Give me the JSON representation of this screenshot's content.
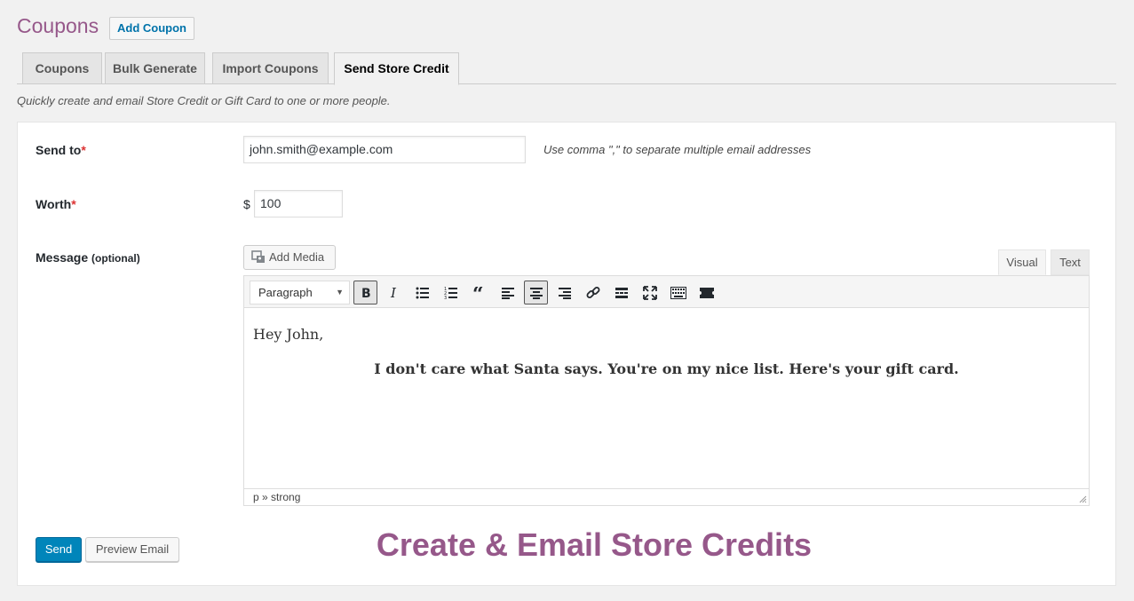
{
  "header": {
    "title": "Coupons",
    "add_button": "Add Coupon"
  },
  "tabs": [
    {
      "label": "Coupons"
    },
    {
      "label": "Bulk Generate"
    },
    {
      "label": "Import Coupons"
    },
    {
      "label": "Send Store Credit",
      "active": true
    }
  ],
  "subtitle": "Quickly create and email Store Credit or Gift Card to one or more people.",
  "form": {
    "send_to": {
      "label": "Send to",
      "required_mark": "*",
      "value": "john.smith@example.com",
      "hint": "Use comma \",\" to separate multiple email addresses"
    },
    "worth": {
      "label": "Worth",
      "required_mark": "*",
      "currency": "$",
      "value": "100"
    },
    "message": {
      "label": "Message",
      "optional": "(optional)"
    }
  },
  "editor": {
    "add_media": "Add Media",
    "tab_visual": "Visual",
    "tab_text": "Text",
    "format_select": "Paragraph",
    "toolbar_icons": [
      "bold-icon",
      "italic-icon",
      "bullet-list-icon",
      "numbered-list-icon",
      "blockquote-icon",
      "align-left-icon",
      "align-center-icon",
      "align-right-icon",
      "link-icon",
      "read-more-icon",
      "fullscreen-icon",
      "toolbar-toggle-icon",
      "shortcode-icon"
    ],
    "greeting": "Hey John,",
    "message": "I don't care what Santa says. You're on my nice list. Here's your gift card.",
    "path": "p » strong"
  },
  "actions": {
    "send": "Send",
    "preview": "Preview Email"
  },
  "promo": "Create & Email Store Credits",
  "colors": {
    "brand": "#96588a",
    "primary": "#0085ba",
    "link": "#0073aa",
    "required": "#dc3232"
  }
}
